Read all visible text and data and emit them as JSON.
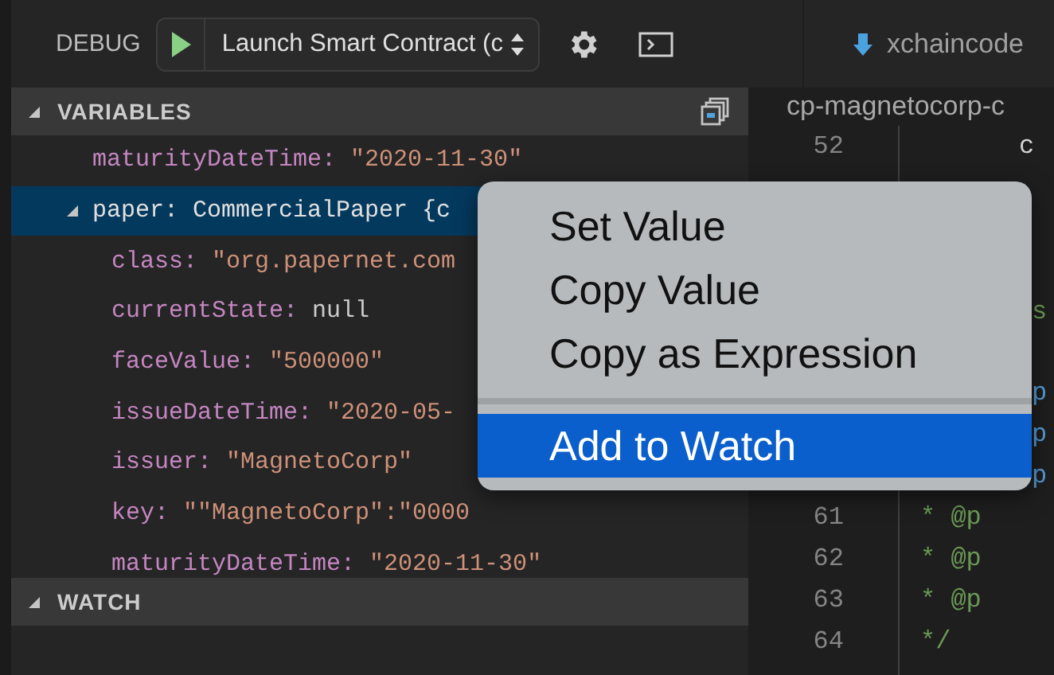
{
  "debug_toolbar": {
    "label": "DEBUG",
    "configuration": "Launch Smart Contract (c"
  },
  "variables": {
    "title": "VARIABLES",
    "expanded": true,
    "rows": [
      {
        "name": "maturityDateTime:",
        "value": "\"2020-11-30\"",
        "kind": "string",
        "selected": false
      },
      {
        "name": "paper:",
        "value": "CommercialPaper {c",
        "kind": "object",
        "expanded": true,
        "selected": true,
        "children": [
          {
            "name": "class:",
            "value": "\"org.papernet.com",
            "kind": "string",
            "selected": false
          },
          {
            "name": "currentState:",
            "value": "null",
            "kind": "null",
            "selected": false
          },
          {
            "name": "faceValue:",
            "value": "\"500000\"",
            "kind": "string",
            "selected": false
          },
          {
            "name": "issueDateTime:",
            "value": "\"2020-05-",
            "kind": "string",
            "selected": false
          },
          {
            "name": "issuer:",
            "value": "\"MagnetoCorp\"",
            "kind": "string",
            "selected": false
          },
          {
            "name": "key:",
            "value": "\"\"MagnetoCorp\":\"0000",
            "kind": "string",
            "selected": false
          },
          {
            "name": "maturityDateTime:",
            "value": "\"2020-11-30\"",
            "kind": "string",
            "selected": false
          }
        ]
      }
    ]
  },
  "watch": {
    "title": "WATCH",
    "expanded": true
  },
  "editor": {
    "tab": "xchaincode",
    "breadcrumb": "cp-magnetocorp-c",
    "lines": [
      {
        "kind": "numbered",
        "number": "52",
        "code": "c"
      },
      {
        "kind": "covered"
      },
      {
        "kind": "covered"
      },
      {
        "kind": "covered"
      },
      {
        "kind": "fragment",
        "code": "s"
      },
      {
        "kind": "covered"
      },
      {
        "kind": "fragment",
        "code": "p"
      },
      {
        "kind": "fragment",
        "code": "p"
      },
      {
        "kind": "fragment",
        "code": "p"
      },
      {
        "kind": "numbered",
        "number": "61",
        "code": "* @p"
      },
      {
        "kind": "numbered",
        "number": "62",
        "code": "* @p"
      },
      {
        "kind": "numbered",
        "number": "63",
        "code": "* @p"
      },
      {
        "kind": "numbered",
        "number": "64",
        "code": "*/"
      }
    ]
  },
  "context_menu": {
    "items": [
      {
        "label": "Set Value",
        "selected": false
      },
      {
        "label": "Copy Value",
        "selected": false
      },
      {
        "label": "Copy as Expression",
        "selected": false,
        "separator_after": true
      },
      {
        "label": "Add to Watch",
        "selected": true
      }
    ]
  }
}
